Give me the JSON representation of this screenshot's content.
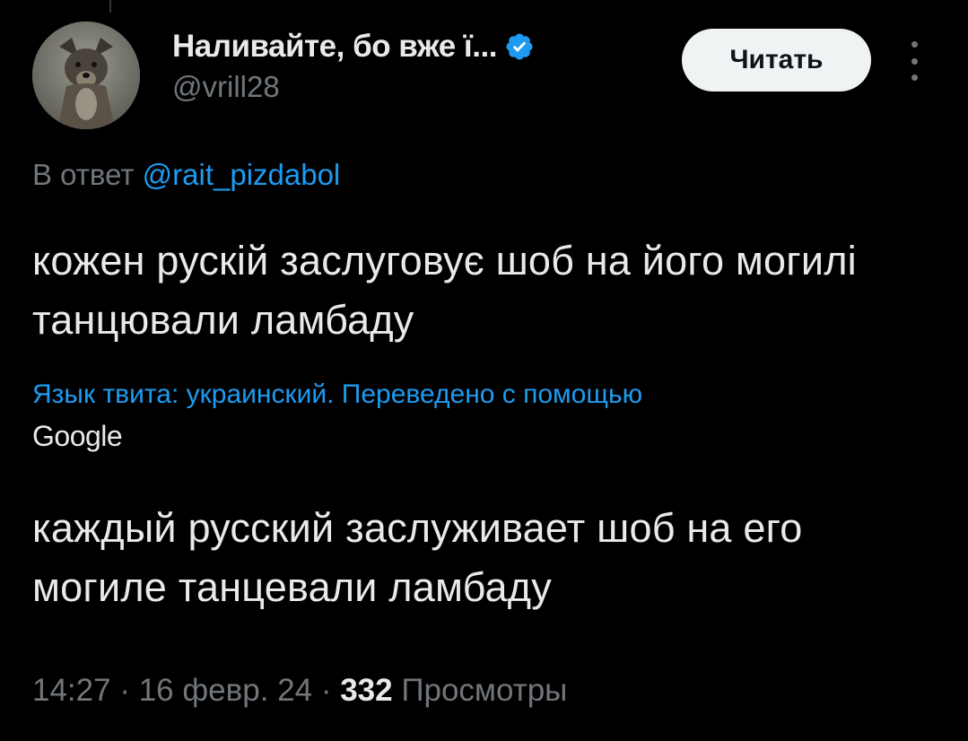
{
  "author": {
    "display_name": "Наливайте, бо вже ї...",
    "handle": "@vrill28"
  },
  "follow_label": "Читать",
  "reply": {
    "prefix": "В ответ",
    "mention": "@rait_pizdabol"
  },
  "tweet": {
    "text": "кожен рускій заслуговує шоб на його могилі танцювали ламбаду",
    "translation_note": "Язык твита: украинский. Переведено с помощью",
    "translation_provider": "Google",
    "translated_text": "каждый русский заслуживает шоб на его могиле танцевали ламбаду"
  },
  "meta": {
    "time": "14:27",
    "separator": "·",
    "date": "16 февр. 24",
    "views_count": "332",
    "views_label": "Просмотры"
  },
  "colors": {
    "background": "#000000",
    "text": "#e7e9ea",
    "secondary": "#71767b",
    "accent": "#1d9bf0"
  },
  "icons": [
    "verified-badge-icon",
    "more-options-icon"
  ]
}
